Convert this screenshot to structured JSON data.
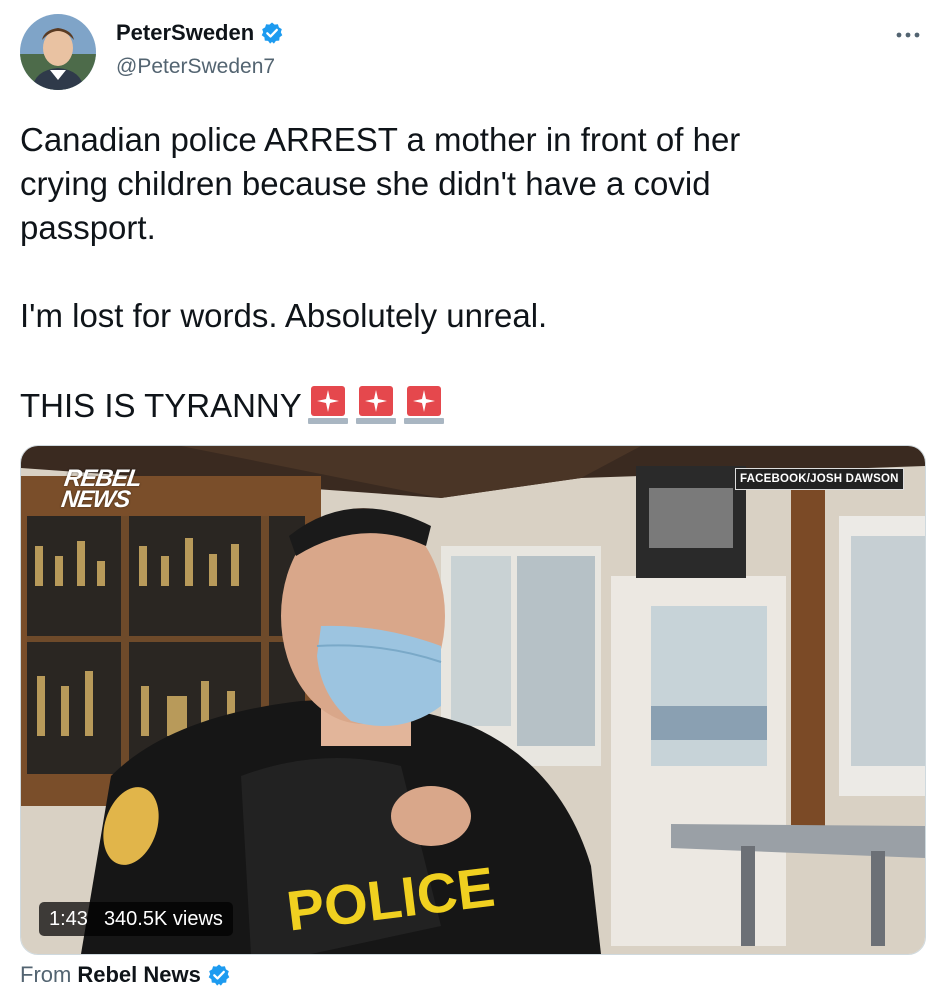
{
  "tweet": {
    "display_name": "PeterSweden",
    "handle": "@PeterSweden7",
    "text_lines": [
      "Canadian police ARREST a mother in front of her",
      "crying children because she didn't have a covid",
      "passport.",
      "I'm lost for words. Absolutely unreal.",
      "THIS IS TYRANNY"
    ],
    "emoji": [
      "police-car-light",
      "police-car-light",
      "police-car-light"
    ]
  },
  "media": {
    "overlay_logo_line1": "REBEL",
    "overlay_logo_line2": "NEWS",
    "credit": "FACEBOOK/JOSH DAWSON",
    "vest_label": "POLICE",
    "duration": "1:43",
    "views": "340.5K views"
  },
  "source": {
    "prefix": "From",
    "name": "Rebel News"
  },
  "colors": {
    "verified": "#1d9bf0",
    "muted_text": "#536471",
    "vest_yellow": "#f0d020"
  }
}
